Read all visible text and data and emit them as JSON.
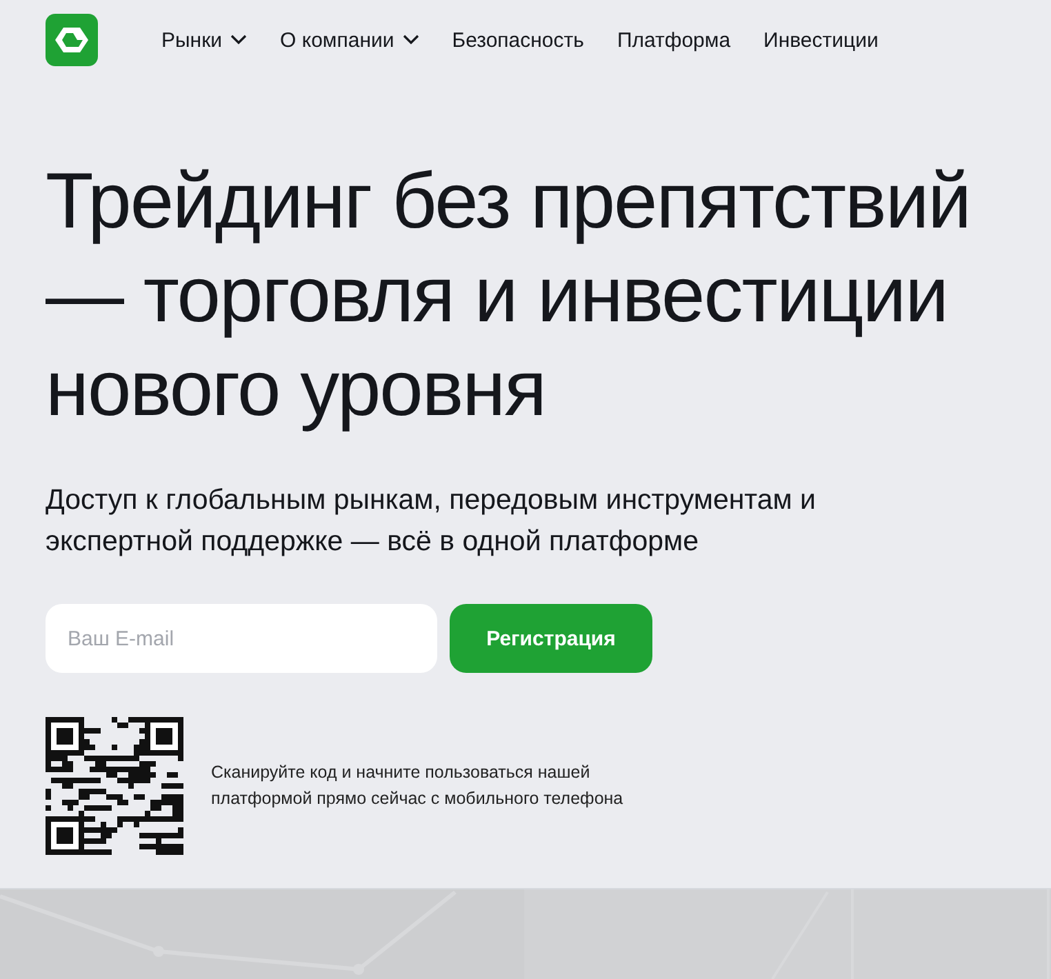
{
  "nav": {
    "items": [
      {
        "label": "Рынки",
        "has_dropdown": true
      },
      {
        "label": "О компании",
        "has_dropdown": true
      },
      {
        "label": "Безопасность",
        "has_dropdown": false
      },
      {
        "label": "Платформа",
        "has_dropdown": false
      },
      {
        "label": "Инвестиции",
        "has_dropdown": false
      }
    ]
  },
  "hero": {
    "title": "Трейдинг без препятствий — торговля и инвестиции нового уровня",
    "subtitle": "Доступ к глобальным рынкам, передовым инструментам и экспертной поддержке — всё в одной платформе",
    "email": {
      "placeholder": "Ваш E-mail"
    },
    "button": "Регистрация"
  },
  "qr": {
    "caption": "Сканируйте код и начните пользоваться нашей платформой прямо сейчас с мобильного телефона"
  }
}
